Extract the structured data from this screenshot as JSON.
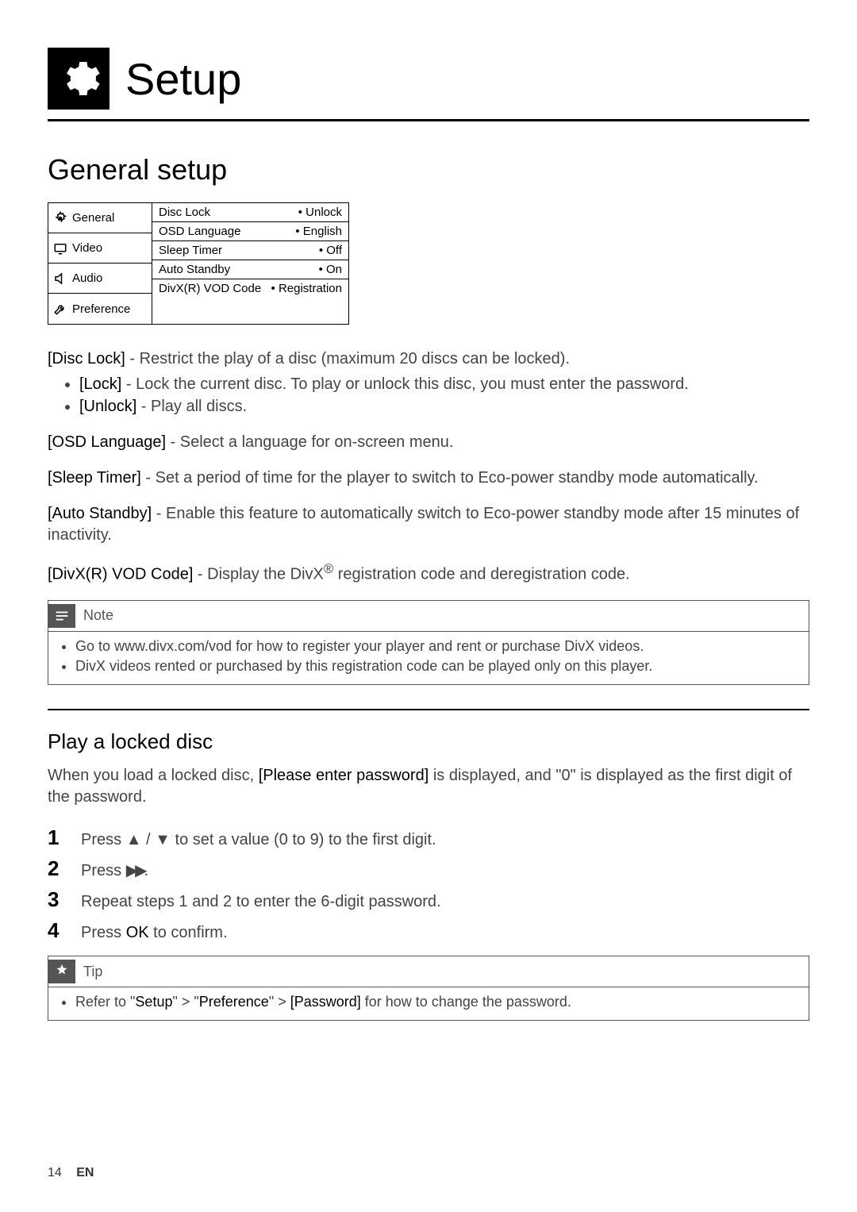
{
  "header": {
    "title": "Setup"
  },
  "section": {
    "title": "General setup"
  },
  "menu": {
    "left": [
      {
        "label": "General",
        "active": true
      },
      {
        "label": "Video"
      },
      {
        "label": "Audio"
      },
      {
        "label": "Preference"
      }
    ],
    "right": [
      {
        "label": "Disc Lock",
        "value": "Unlock"
      },
      {
        "label": "OSD Language",
        "value": "English"
      },
      {
        "label": "Sleep Timer",
        "value": "Off"
      },
      {
        "label": "Auto Standby",
        "value": "On"
      },
      {
        "label": "DivX(R) VOD Code",
        "value": "Registration"
      }
    ]
  },
  "desc": {
    "disc_lock_head": "[Disc Lock]",
    "disc_lock_body": " - Restrict the play of a disc (maximum 20 discs can be locked).",
    "lock_head": "[Lock]",
    "lock_body": " - Lock the current disc. To play or unlock this disc, you must enter the password.",
    "unlock_head": "[Unlock]",
    "unlock_body": " - Play all discs.",
    "osd_head": "[OSD Language]",
    "osd_body": " - Select a language for on-screen menu.",
    "sleep_head": "[Sleep Timer]",
    "sleep_body": " - Set a period of time for the player to switch to Eco-power standby mode automatically.",
    "auto_head": "[Auto Standby]",
    "auto_body": " - Enable this feature to automatically switch to Eco-power standby mode after 15 minutes of inactivity.",
    "divx_head": "[DivX(R) VOD Code]",
    "divx_body_a": " - Display the DivX",
    "divx_body_b": " registration code and deregistration code."
  },
  "note": {
    "label": "Note",
    "items": [
      "Go to www.divx.com/vod for how to register your player and rent or purchase DivX videos.",
      "DivX videos rented or purchased by this registration code can be played only on this player."
    ]
  },
  "locked": {
    "title": "Play a locked disc",
    "intro_a": "When you load a locked disc, ",
    "intro_bold": "[Please enter password]",
    "intro_b": " is displayed, and \"0\" is displayed as the first digit of the password.",
    "steps": [
      {
        "n": "1",
        "text_a": "Press ",
        "text_b": " to set a value (0 to 9) to the first digit.",
        "icons": "updown"
      },
      {
        "n": "2",
        "text_a": "Press ",
        "text_b": ".",
        "icons": "ff"
      },
      {
        "n": "3",
        "text_a": "Repeat steps 1 and 2 to enter the 6-digit password.",
        "text_b": "",
        "icons": ""
      },
      {
        "n": "4",
        "text_a": "Press ",
        "bold": "OK",
        "text_b": " to confirm.",
        "icons": ""
      }
    ]
  },
  "tip": {
    "label": "Tip",
    "item_a": "Refer to \"",
    "item_b1": "Setup",
    "item_c": "\" > \"",
    "item_b2": "Preference",
    "item_d": "\" > ",
    "item_b3": "[Password]",
    "item_e": " for how to change the password."
  },
  "footer": {
    "page": "14",
    "lang": "EN"
  }
}
